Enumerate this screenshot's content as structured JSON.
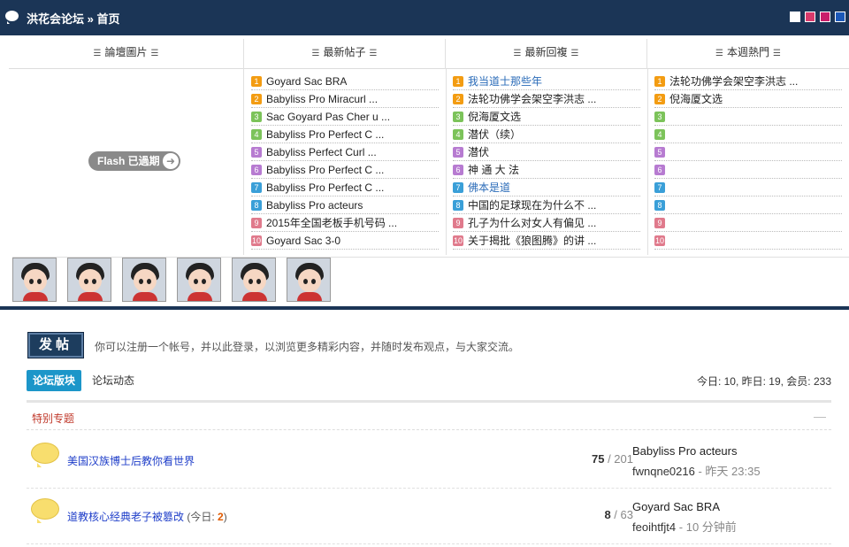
{
  "header": {
    "forum_name": "洪花会论坛",
    "separator": "»",
    "current": "首页",
    "swatches": [
      "#ffffff",
      "#d83a6b",
      "#c91d6a",
      "#1b58b8"
    ]
  },
  "portal": {
    "tabs": [
      "論壇圖片",
      "最新帖子",
      "最新回複",
      "本週熱門"
    ],
    "flash_text": "Flash 已過期",
    "latest_posts": [
      "Goyard Sac BRA",
      "Babyliss Pro Miracurl ...",
      "Sac Goyard Pas Cher u ...",
      "Babyliss Pro Perfect C ...",
      "Babyliss Perfect Curl ...",
      "Babyliss Pro Perfect C ...",
      "Babyliss Pro Perfect C ...",
      "Babyliss Pro acteurs",
      "2015年全国老板手机号码 ...",
      "Goyard Sac 3-0"
    ],
    "latest_replies": [
      "我当道士那些年",
      "法轮功佛学会架空李洪志 ...",
      "倪海厦文选",
      "潜伏（续）",
      "潜伏",
      "神 通 大 法",
      "佛本是道",
      "中国的足球现在为什么不 ...",
      "孔子为什么对女人有偏见 ...",
      "关于揭批《狼图腾》的讲 ..."
    ],
    "weekly_hot": [
      "法轮功佛学会架空李洪志 ...",
      "倪海厦文选",
      "",
      "",
      "",
      "",
      "",
      "",
      "",
      ""
    ],
    "rank_colors": [
      "#f39c12",
      "#f39c12",
      "#7cc35a",
      "#7cc35a",
      "#b77bd1",
      "#b77bd1",
      "#3a9fd8",
      "#3a9fd8",
      "#e07a8c",
      "#e07a8c"
    ],
    "numbers": [
      "1",
      "2",
      "3",
      "4",
      "5",
      "6",
      "7",
      "8",
      "9",
      "10"
    ]
  },
  "main": {
    "post_button": "发帖",
    "hint": "你可以注册一个帐号，并以此登录，以浏览更多精彩内容，并随时发布观点，与大家交流。",
    "tab_active": "论坛版块",
    "tab_other": "论坛动态",
    "stats": "今日: 10, 昨日: 19, 会员: 233",
    "section_title": "特别专题",
    "collapse": "—",
    "forums": [
      {
        "name": "美国汉族博士后教你看世界",
        "today_label": "",
        "today_count": "",
        "threads": "75",
        "posts": "201",
        "last_title": "Babyliss Pro acteurs",
        "last_user": "fwnqne0216",
        "last_time": "昨天 23:35"
      },
      {
        "name": "道教核心经典老子被篡改",
        "today_label": "(今日: ",
        "today_count": "2",
        "threads": "8",
        "posts": "63",
        "last_title": "Goyard Sac BRA",
        "last_user": "feoihtfjt4",
        "last_time": "10 分钟前"
      }
    ]
  }
}
